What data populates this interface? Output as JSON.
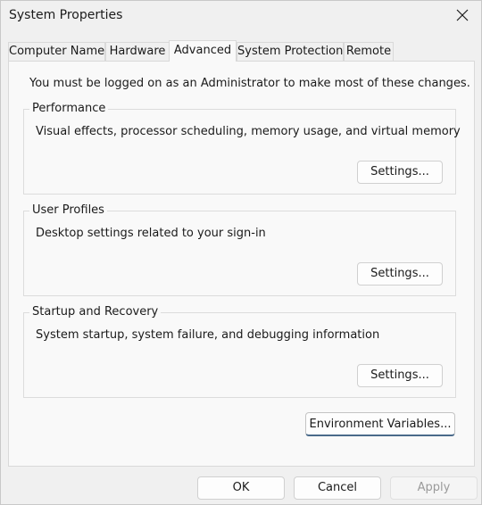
{
  "window": {
    "title": "System Properties",
    "close_icon": "close-icon"
  },
  "tabs": [
    {
      "label": "Computer Name",
      "active": false
    },
    {
      "label": "Hardware",
      "active": false
    },
    {
      "label": "Advanced",
      "active": true
    },
    {
      "label": "System Protection",
      "active": false
    },
    {
      "label": "Remote",
      "active": false
    }
  ],
  "notice": "You must be logged on as an Administrator to make most of these changes.",
  "groups": {
    "performance": {
      "title": "Performance",
      "description": "Visual effects, processor scheduling, memory usage, and virtual memory",
      "button": "Settings..."
    },
    "user_profiles": {
      "title": "User Profiles",
      "description": "Desktop settings related to your sign-in",
      "button": "Settings..."
    },
    "startup_recovery": {
      "title": "Startup and Recovery",
      "description": "System startup, system failure, and debugging information",
      "button": "Settings..."
    }
  },
  "environment_button": "Environment Variables...",
  "footer": {
    "ok": "OK",
    "cancel": "Cancel",
    "apply": "Apply",
    "apply_enabled": false
  },
  "colors": {
    "background": "#f0f0f0",
    "panel": "#f9f9f9",
    "focus_accent": "#4a6a8a"
  }
}
